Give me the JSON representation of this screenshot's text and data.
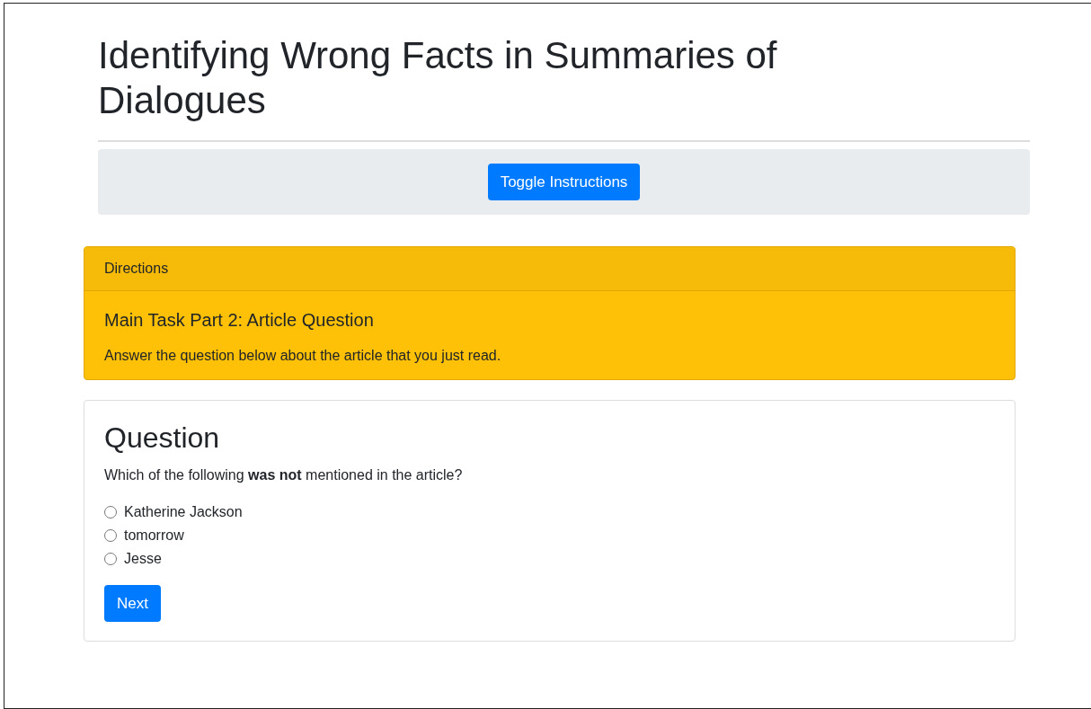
{
  "title": "Identifying Wrong Facts in Summaries of Dialogues",
  "toggle_button": "Toggle Instructions",
  "directions": {
    "header": "Directions",
    "heading": "Main Task Part 2: Article Question",
    "text": "Answer the question below about the article that you just read."
  },
  "question": {
    "heading": "Question",
    "prompt": "Which of the following **was not** mentioned in the article?",
    "options": [
      {
        "label": "Katherine Jackson",
        "selected": false
      },
      {
        "label": "tomorrow",
        "selected": false
      },
      {
        "label": "Jesse",
        "selected": false
      }
    ],
    "next_button": "Next"
  }
}
